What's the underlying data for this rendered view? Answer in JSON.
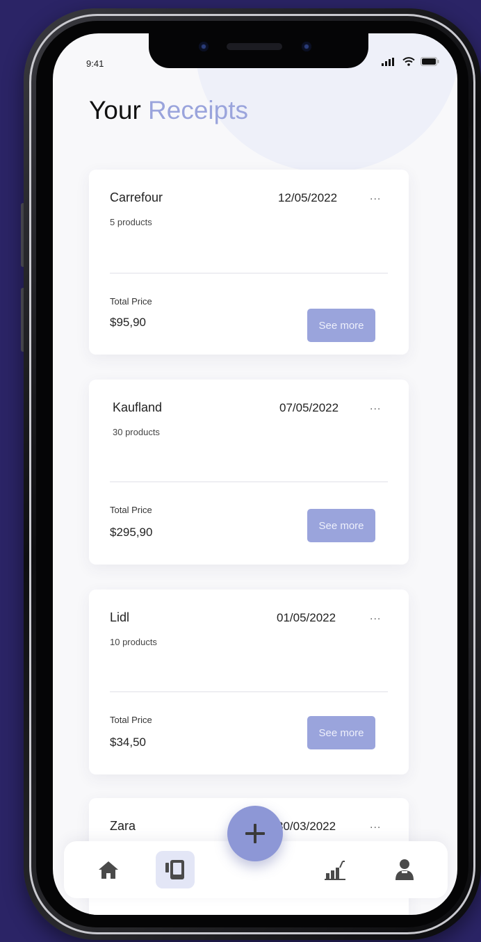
{
  "status_bar": {
    "time": "9:41",
    "signal_icon": "signal-icon",
    "wifi_icon": "wifi-icon",
    "battery_icon": "battery-icon"
  },
  "header": {
    "title_primary": "Your",
    "title_accent": "Receipts"
  },
  "receipts": [
    {
      "store": "Carrefour",
      "products": "5 products",
      "date": "12/05/2022",
      "menu": "...",
      "total_label": "Total Price",
      "total_value": "$95,90",
      "button_label": "See more"
    },
    {
      "store": "Kaufland",
      "products": "30 products",
      "date": "07/05/2022",
      "menu": "...",
      "total_label": "Total Price",
      "total_value": "$295,90",
      "button_label": "See more"
    },
    {
      "store": "Lidl",
      "products": "10 products",
      "date": "01/05/2022",
      "menu": "...",
      "total_label": "Total Price",
      "total_value": "$34,50",
      "button_label": "See more"
    },
    {
      "store": "Zara",
      "date": "30/03/2022",
      "menu": "..."
    }
  ],
  "bottom_nav": {
    "items": [
      {
        "icon": "home-icon",
        "active": false
      },
      {
        "icon": "receipt-icon",
        "active": true
      },
      {
        "icon": "chart-icon",
        "active": false
      },
      {
        "icon": "profile-icon",
        "active": false
      }
    ],
    "fab_icon": "plus-icon"
  },
  "colors": {
    "background": "#2b2466",
    "accent": "#9aa4dc",
    "fab": "#8d97d6",
    "active_tab": "#e3e6f6",
    "screen": "#f8f8fa",
    "card": "#ffffff"
  }
}
